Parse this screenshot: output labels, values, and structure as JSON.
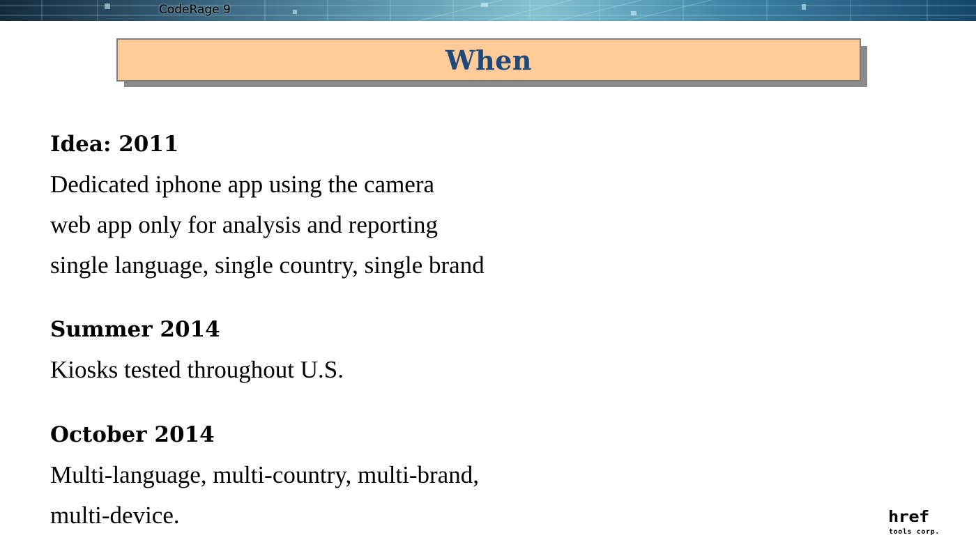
{
  "banner": {
    "title": "CodeRage 9"
  },
  "slide": {
    "title": "When",
    "sections": [
      {
        "heading": "Idea: 2011",
        "lines": [
          "Dedicated iphone app using the camera",
          "web app only for analysis and reporting",
          "single language, single country, single brand"
        ]
      },
      {
        "heading": "Summer 2014",
        "lines": [
          "Kiosks tested throughout U.S."
        ]
      },
      {
        "heading": "October 2014",
        "lines": [
          "Multi-language, multi-country, multi-brand,",
          "multi-device."
        ]
      }
    ]
  },
  "logo": {
    "main": "href",
    "sub": "tools corp."
  },
  "colors": {
    "title_box_fill": "#ffcc99",
    "title_text": "#1f497d",
    "title_shadow": "#8a8a8a"
  }
}
